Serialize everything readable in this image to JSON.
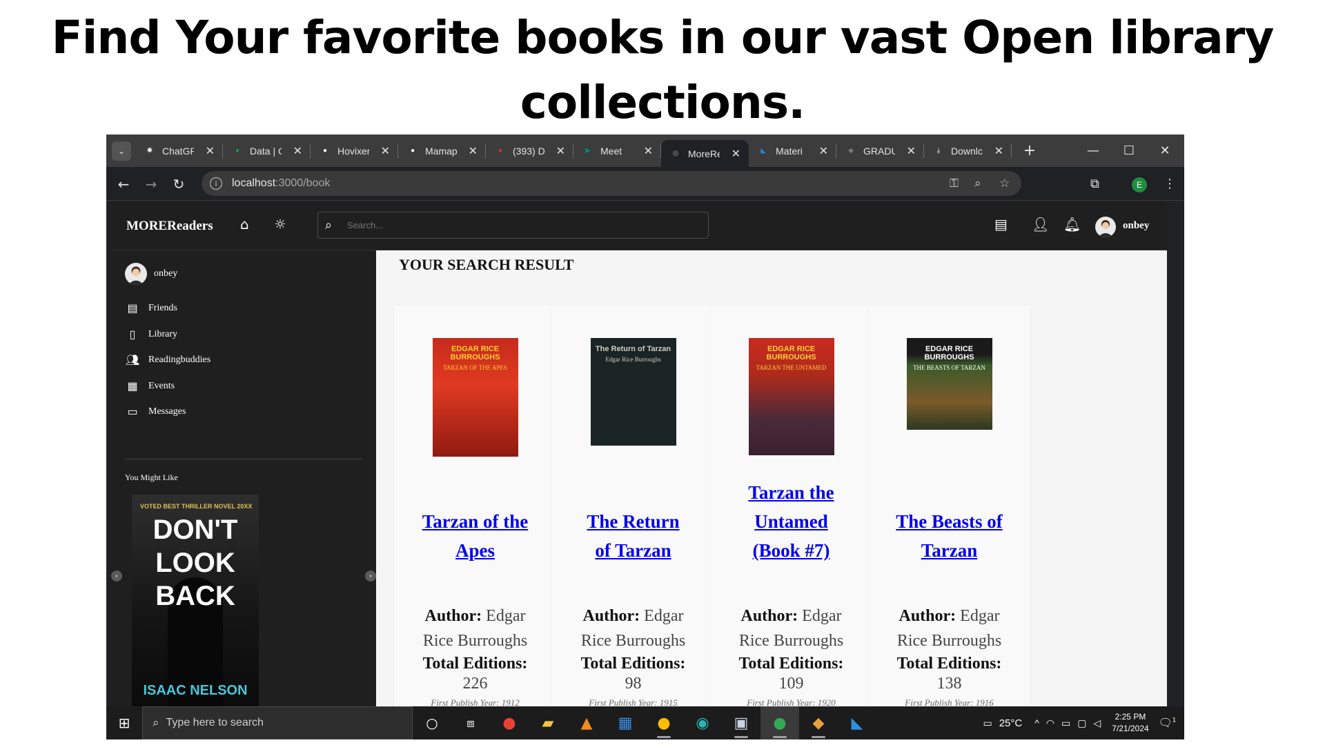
{
  "headline": "Find Your favorite books in our vast Open library collections.",
  "browser": {
    "tabs": [
      {
        "label": "ChatGP",
        "icon": "chatgpt-icon",
        "color": "#ffffff"
      },
      {
        "label": "Data | C",
        "icon": "mongodb-icon",
        "color": "#13aa52"
      },
      {
        "label": "Hovixer",
        "icon": "github-icon",
        "color": "#ffffff"
      },
      {
        "label": "Mamap",
        "icon": "github-icon",
        "color": "#ffffff"
      },
      {
        "label": "(393) D",
        "icon": "notification-badge-icon",
        "color": "#d93025"
      },
      {
        "label": "Meet",
        "icon": "google-meet-icon",
        "color": "#00897b"
      },
      {
        "label": "MoreRe",
        "icon": "globe-icon",
        "color": "#9aa0a6",
        "active": true
      },
      {
        "label": "Materi",
        "icon": "mui-icon",
        "color": "#1e88e5"
      },
      {
        "label": "GRADU",
        "icon": "site-icon",
        "color": "#777777"
      },
      {
        "label": "Downlc",
        "icon": "download-icon",
        "color": "#ffffff"
      }
    ],
    "url_host": "localhost",
    "url_path": ":3000/book",
    "profile_initial": "E"
  },
  "app": {
    "brand": "MOREReaders",
    "search_placeholder": "Search...",
    "username": "onbey",
    "sidebar": {
      "user": "onbey",
      "items": [
        {
          "label": "Friends",
          "icon": "friends-icon"
        },
        {
          "label": "Library",
          "icon": "library-icon"
        },
        {
          "label": "Readingbuddies",
          "icon": "reading-buddies-icon"
        },
        {
          "label": "Events",
          "icon": "calendar-icon"
        },
        {
          "label": "Messages",
          "icon": "messages-icon"
        }
      ],
      "might_like": "You Might Like",
      "promo": {
        "tag": "VOTED BEST THRILLER NOVEL 20XX",
        "line1": "DON'T",
        "line2": "LOOK",
        "line3": "BACK",
        "author": "ISAAC NELSON"
      }
    },
    "result_heading": "YOUR SEARCH RESULT",
    "books": [
      {
        "title": "Tarzan of the Apes",
        "cover_text": "EDGAR RICE BURROUGHS",
        "cover_sub": "TARZAN OF THE APES",
        "author_label": "Author:",
        "author": "Edgar Rice Burroughs",
        "editions_label": "Total Editions:",
        "editions": "226",
        "first_publish": "First Publish Year: 1912"
      },
      {
        "title": "The Return of Tarzan",
        "cover_text": "The Return of Tarzan",
        "cover_sub": "Edgar Rice Burroughs",
        "author_label": "Author:",
        "author": "Edgar Rice Burroughs",
        "editions_label": "Total Editions:",
        "editions": "98",
        "first_publish": "First Publish Year: 1915"
      },
      {
        "title": "Tarzan the Untamed (Book #7)",
        "cover_text": "EDGAR RICE BURROUGHS",
        "cover_sub": "TARZAN THE UNTAMED",
        "author_label": "Author:",
        "author": "Edgar Rice Burroughs",
        "editions_label": "Total Editions:",
        "editions": "109",
        "first_publish": "First Publish Year: 1920"
      },
      {
        "title": "The Beasts of Tarzan",
        "cover_text": "EDGAR RICE BURROUGHS",
        "cover_sub": "THE BEASTS OF TARZAN",
        "author_label": "Author:",
        "author": "Edgar Rice Burroughs",
        "editions_label": "Total Editions:",
        "editions": "138",
        "first_publish": "First Publish Year: 1916"
      }
    ]
  },
  "taskbar": {
    "search_placeholder": "Type here to search",
    "temperature": "25°C",
    "time": "2:25 PM",
    "date": "7/21/2024",
    "notification_count": "1"
  }
}
